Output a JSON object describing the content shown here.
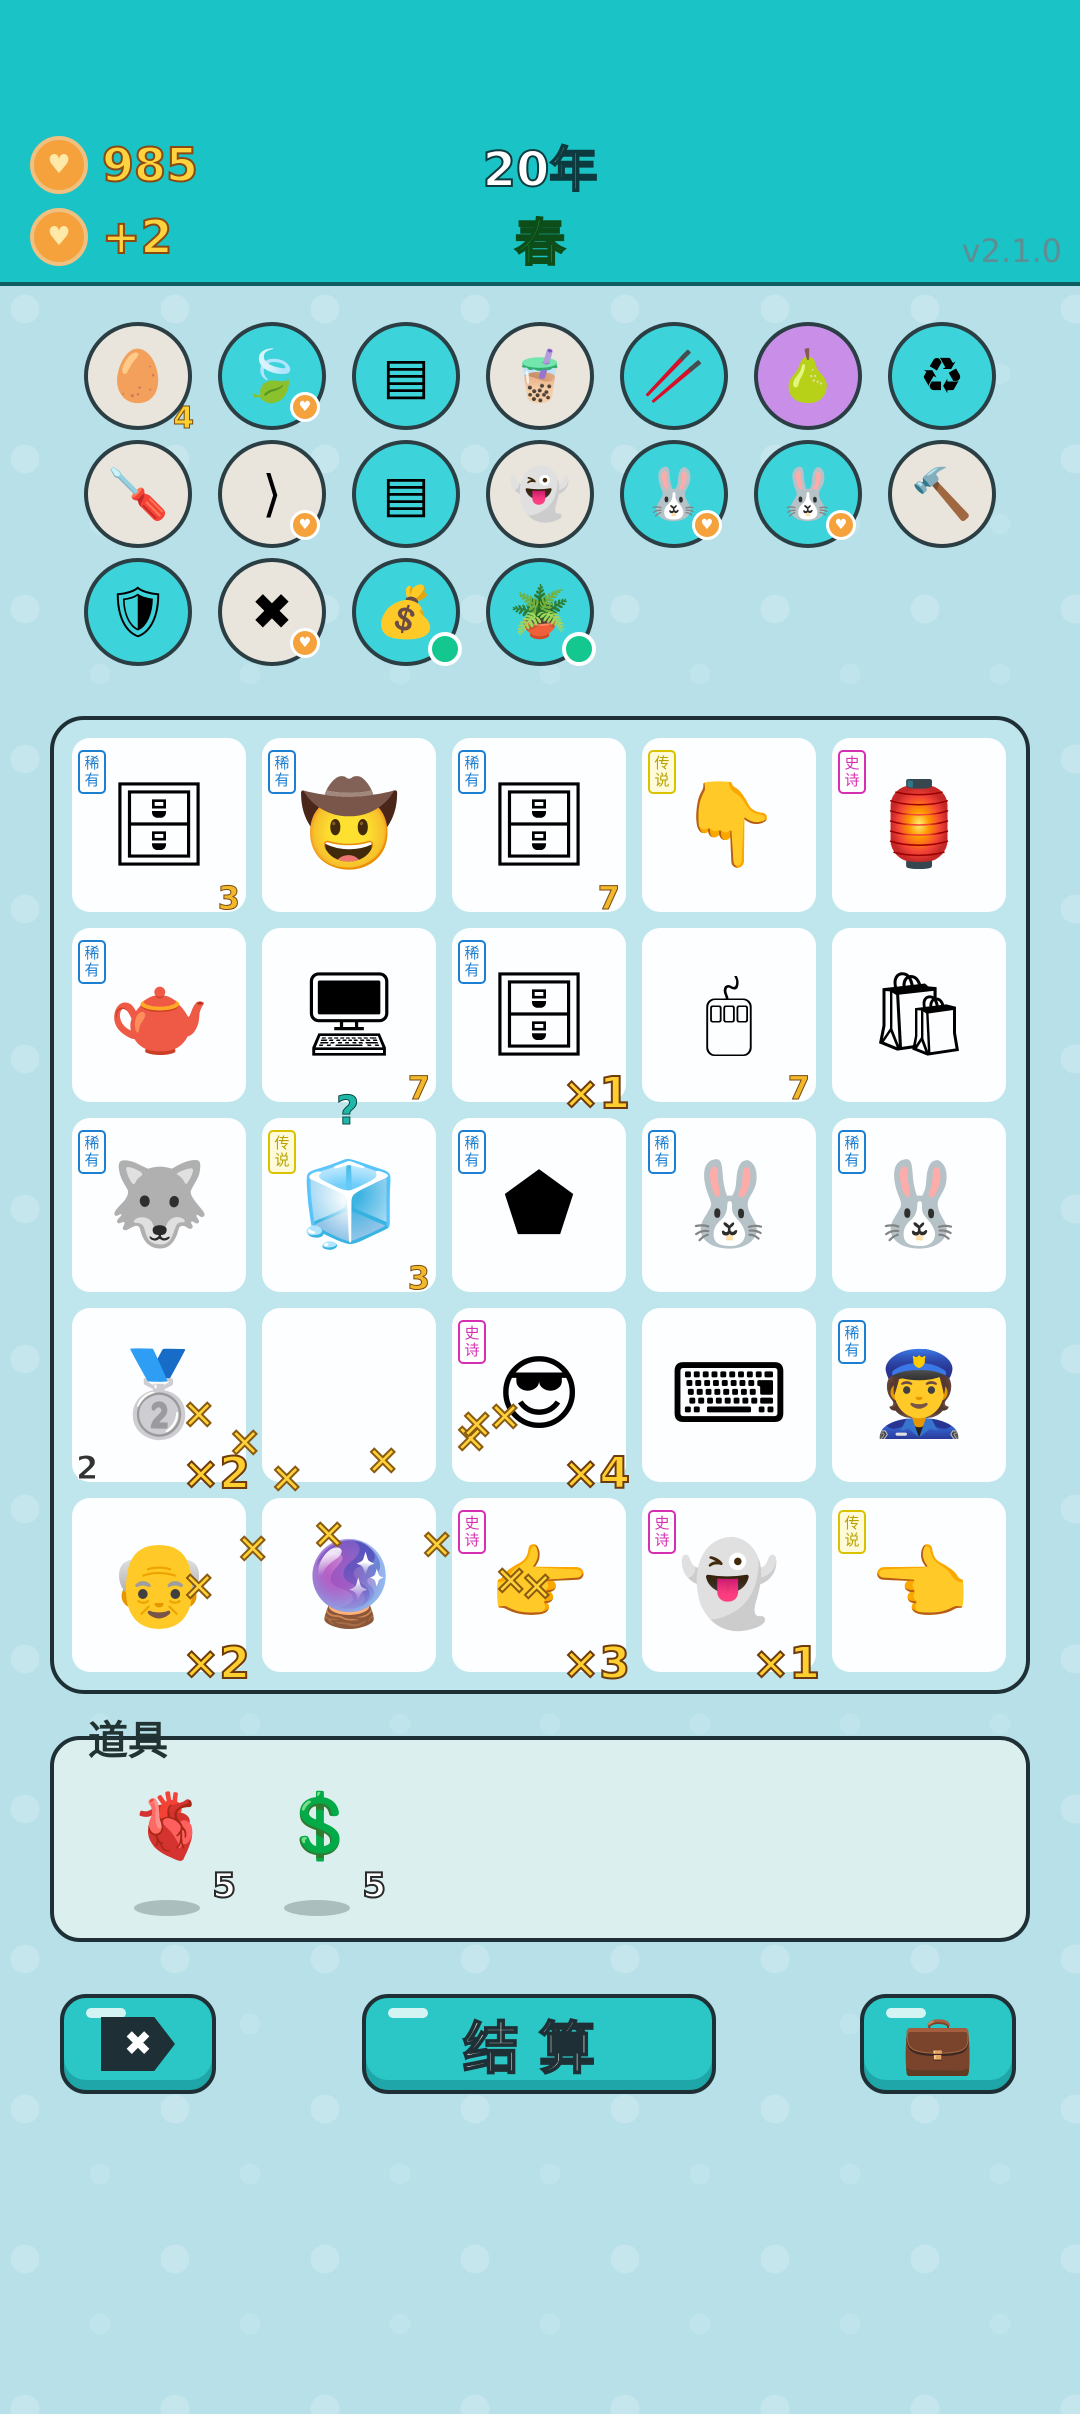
{
  "header": {
    "coins": "985",
    "income": "+2",
    "year": "20年",
    "season": "春",
    "version": "v2.1.0"
  },
  "symbols": [
    {
      "name": "egg-carton-icon",
      "glyph": "🥚",
      "bg": "#e9e4dc",
      "count": "4",
      "badge": "none"
    },
    {
      "name": "leaf-icon",
      "glyph": "🍃",
      "bg": "#3dd3da",
      "count": "",
      "badge": "heart"
    },
    {
      "name": "pleated-skirt-icon",
      "glyph": "▤",
      "bg": "#3dd3da",
      "count": "",
      "badge": "none"
    },
    {
      "name": "bubble-tea-icon",
      "glyph": "🧋",
      "bg": "#e9e4dc",
      "count": "",
      "badge": "none"
    },
    {
      "name": "chopsticks-icon",
      "glyph": "🥢",
      "bg": "#3dd3da",
      "count": "",
      "badge": "none"
    },
    {
      "name": "pomelo-icon",
      "glyph": "🍐",
      "bg": "#c98ee8",
      "count": "",
      "badge": "none"
    },
    {
      "name": "recycle-bag-icon",
      "glyph": "♻",
      "bg": "#3dd3da",
      "count": "",
      "badge": "none"
    },
    {
      "name": "screwdriver-icon",
      "glyph": "🪛",
      "bg": "#e9e4dc",
      "count": "",
      "badge": "none"
    },
    {
      "name": "tongs-icon",
      "glyph": "⟩",
      "bg": "#e9e4dc",
      "count": "",
      "badge": "heart"
    },
    {
      "name": "pleated-skirt-icon-2",
      "glyph": "▤",
      "bg": "#3dd3da",
      "count": "",
      "badge": "none"
    },
    {
      "name": "ghost-icon",
      "glyph": "👻",
      "bg": "#e9e4dc",
      "count": "",
      "badge": "none"
    },
    {
      "name": "bunny-icon",
      "glyph": "🐰",
      "bg": "#3dd3da",
      "count": "",
      "badge": "heart"
    },
    {
      "name": "bunny-icon-2",
      "glyph": "🐰",
      "bg": "#3dd3da",
      "count": "",
      "badge": "heart"
    },
    {
      "name": "hammer-icon",
      "glyph": "🔨",
      "bg": "#e9e4dc",
      "count": "",
      "badge": "none"
    },
    {
      "name": "shield-wrench-icon",
      "glyph": "🛡",
      "bg": "#3dd3da",
      "count": "",
      "badge": "none"
    },
    {
      "name": "delete-tag-icon",
      "glyph": "✖",
      "bg": "#e9e4dc",
      "count": "",
      "badge": "heart"
    },
    {
      "name": "money-bag-icon",
      "glyph": "💰",
      "bg": "#3dd3da",
      "count": "",
      "badge": "green"
    },
    {
      "name": "potted-flower-icon",
      "glyph": "🪴",
      "bg": "#3dd3da",
      "count": "",
      "badge": "green"
    }
  ],
  "board": [
    {
      "name": "server-tower-icon",
      "glyph": "🗄",
      "rarity": "稀有",
      "rclass": "rare",
      "count": "3",
      "mult": ""
    },
    {
      "name": "hat-man-face-icon",
      "glyph": "🤠",
      "rarity": "稀有",
      "rclass": "rare",
      "count": "",
      "mult": ""
    },
    {
      "name": "server-tower-icon",
      "glyph": "🗄",
      "rarity": "稀有",
      "rclass": "rare",
      "count": "7",
      "mult": ""
    },
    {
      "name": "pointing-hand-icon",
      "glyph": "👇",
      "rarity": "传说",
      "rclass": "legend",
      "count": "",
      "mult": ""
    },
    {
      "name": "bunny-house-icon",
      "glyph": "🏮",
      "rarity": "史诗",
      "rclass": "epic",
      "count": "",
      "mult": ""
    },
    {
      "name": "teapot-icon",
      "glyph": "🫖",
      "rarity": "稀有",
      "rclass": "rare",
      "count": "",
      "mult": ""
    },
    {
      "name": "monitor-icon",
      "glyph": "🖥",
      "rarity": "",
      "rclass": "",
      "count": "7",
      "mult": ""
    },
    {
      "name": "server-tower-icon",
      "glyph": "🗄",
      "rarity": "稀有",
      "rclass": "rare",
      "count": "",
      "mult": "×1"
    },
    {
      "name": "mouse-icon",
      "glyph": "🖱",
      "rarity": "",
      "rclass": "",
      "count": "7",
      "mult": ""
    },
    {
      "name": "garbage-bag-icon",
      "glyph": "🛍",
      "rarity": "",
      "rclass": "",
      "count": "",
      "mult": ""
    },
    {
      "name": "husky-dog-icon",
      "glyph": "🐺",
      "rarity": "稀有",
      "rclass": "rare",
      "count": "",
      "mult": ""
    },
    {
      "name": "fridge-icon",
      "glyph": "🧊",
      "rarity": "传说",
      "rclass": "legend",
      "count": "3",
      "mult": ""
    },
    {
      "name": "wood-element-icon",
      "glyph": "⬟",
      "rarity": "稀有",
      "rclass": "rare",
      "count": "",
      "mult": ""
    },
    {
      "name": "bunny-icon",
      "glyph": "🐰",
      "rarity": "稀有",
      "rclass": "rare",
      "count": "",
      "mult": ""
    },
    {
      "name": "bunny-icon",
      "glyph": "🐰",
      "rarity": "稀有",
      "rclass": "rare",
      "count": "",
      "mult": ""
    },
    {
      "name": "silver-bars-icon",
      "glyph": "🥈",
      "rarity": "",
      "rclass": "",
      "count": "2",
      "mult": "×2"
    },
    {
      "name": "empty-cell",
      "glyph": "",
      "rarity": "",
      "rclass": "",
      "count": "",
      "mult": ""
    },
    {
      "name": "green-cap-man-icon",
      "glyph": "😎",
      "rarity": "史诗",
      "rclass": "epic",
      "count": "",
      "mult": "×4"
    },
    {
      "name": "keyboard-icon",
      "glyph": "⌨",
      "rarity": "",
      "rclass": "",
      "count": "",
      "mult": ""
    },
    {
      "name": "police-officer-icon",
      "glyph": "👮",
      "rarity": "稀有",
      "rclass": "rare",
      "count": "",
      "mult": ""
    },
    {
      "name": "old-man-face-icon",
      "glyph": "👴",
      "rarity": "",
      "rclass": "",
      "count": "",
      "mult": "×2"
    },
    {
      "name": "math-ball-icon",
      "glyph": "🔮",
      "rarity": "",
      "rclass": "",
      "count": "",
      "mult": ""
    },
    {
      "name": "gray-pointing-hand-icon",
      "glyph": "👉",
      "rarity": "史诗",
      "rclass": "epic",
      "count": "",
      "mult": "×3"
    },
    {
      "name": "dead-ghost-icon",
      "glyph": "👻",
      "rarity": "史诗",
      "rclass": "epic",
      "count": "",
      "mult": "×1"
    },
    {
      "name": "yellow-pointing-hand-icon",
      "glyph": "👈",
      "rarity": "传说",
      "rclass": "legend",
      "count": "",
      "mult": ""
    }
  ],
  "items": {
    "title": "道具",
    "list": [
      {
        "name": "liver-item-icon",
        "glyph": "🫀",
        "count": "5"
      },
      {
        "name": "coin-item-icon",
        "glyph": "💲",
        "count": "5"
      }
    ]
  },
  "buttons": {
    "remove_glyph": "✖",
    "settle_label": "结算",
    "bag_glyph": "💼"
  },
  "fx": {
    "x_glyph": "×",
    "question": "?",
    "heart_glyph": "♥"
  }
}
